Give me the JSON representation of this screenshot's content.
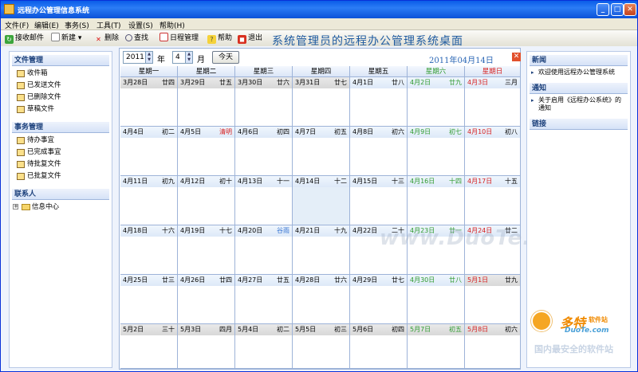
{
  "app": {
    "title": "远程办公管理信息系统",
    "banner": "系统管理员的远程办公管理系统桌面"
  },
  "window_buttons": {
    "minimize": "_",
    "maximize": "□",
    "close": "✕"
  },
  "menu": [
    "文件(F)",
    "编辑(E)",
    "事务(S)",
    "工具(T)",
    "设置(S)",
    "帮助(H)"
  ],
  "toolbar": {
    "receive": "接收邮件",
    "new": "新建",
    "new_arrow": "▾",
    "delete": "删除",
    "find": "查找",
    "schedule": "日程管理",
    "help": "帮助",
    "exit": "退出"
  },
  "sidebar": {
    "files_title": "文件管理",
    "files": [
      "收件箱",
      "已发送文件",
      "已删除文件",
      "草稿文件"
    ],
    "affairs_title": "事务管理",
    "affairs": [
      "待办事宜",
      "已完成事宜",
      "待批复文件",
      "已批复文件"
    ],
    "contacts_title": "联系人",
    "tree_toggle": "+",
    "tree": [
      "信息中心"
    ]
  },
  "calendar": {
    "year": "2011",
    "year_label": "年",
    "month": "4",
    "month_label": "月",
    "today_btn": "今天",
    "current_date": "2011年04月14日",
    "close": "✕",
    "weekdays": [
      "星期一",
      "星期二",
      "星期三",
      "星期四",
      "星期五",
      "星期六",
      "星期日"
    ],
    "weeks": [
      [
        {
          "d": "3月28日",
          "l": "廿四"
        },
        {
          "d": "3月29日",
          "l": "廿五"
        },
        {
          "d": "3月30日",
          "l": "廿六"
        },
        {
          "d": "3月31日",
          "l": "廿七"
        },
        {
          "d": "4月1日",
          "l": "廿八"
        },
        {
          "d": "4月2日",
          "l": "廿九"
        },
        {
          "d": "4月3日",
          "l": "三月"
        }
      ],
      [
        {
          "d": "4月4日",
          "l": "初二"
        },
        {
          "d": "4月5日",
          "l": "清明"
        },
        {
          "d": "4月6日",
          "l": "初四"
        },
        {
          "d": "4月7日",
          "l": "初五"
        },
        {
          "d": "4月8日",
          "l": "初六"
        },
        {
          "d": "4月9日",
          "l": "初七"
        },
        {
          "d": "4月10日",
          "l": "初八"
        }
      ],
      [
        {
          "d": "4月11日",
          "l": "初九"
        },
        {
          "d": "4月12日",
          "l": "初十"
        },
        {
          "d": "4月13日",
          "l": "十一"
        },
        {
          "d": "4月14日",
          "l": "十二"
        },
        {
          "d": "4月15日",
          "l": "十三"
        },
        {
          "d": "4月16日",
          "l": "十四"
        },
        {
          "d": "4月17日",
          "l": "十五"
        }
      ],
      [
        {
          "d": "4月18日",
          "l": "十六"
        },
        {
          "d": "4月19日",
          "l": "十七"
        },
        {
          "d": "4月20日",
          "l": "谷雨"
        },
        {
          "d": "4月21日",
          "l": "十九"
        },
        {
          "d": "4月22日",
          "l": "二十"
        },
        {
          "d": "4月23日",
          "l": "廿一"
        },
        {
          "d": "4月24日",
          "l": "廿二"
        }
      ],
      [
        {
          "d": "4月25日",
          "l": "廿三"
        },
        {
          "d": "4月26日",
          "l": "廿四"
        },
        {
          "d": "4月27日",
          "l": "廿五"
        },
        {
          "d": "4月28日",
          "l": "廿六"
        },
        {
          "d": "4月29日",
          "l": "廿七"
        },
        {
          "d": "4月30日",
          "l": "廿八"
        },
        {
          "d": "5月1日",
          "l": "廿九"
        }
      ],
      [
        {
          "d": "5月2日",
          "l": "三十"
        },
        {
          "d": "5月3日",
          "l": "四月"
        },
        {
          "d": "5月4日",
          "l": "初二"
        },
        {
          "d": "5月5日",
          "l": "初三"
        },
        {
          "d": "5月6日",
          "l": "初四"
        },
        {
          "d": "5月7日",
          "l": "初五"
        },
        {
          "d": "5月8日",
          "l": "初六"
        }
      ]
    ]
  },
  "right_panel": {
    "news_title": "新闻",
    "news": [
      "欢迎使用远程办公管理系统"
    ],
    "notice_title": "通知",
    "notices": [
      "关于启用《远程办公系统》的通知"
    ],
    "links_title": "链接"
  },
  "watermark": {
    "text": "www.DuoTe.com",
    "logo_cn": "多特",
    "logo_sub": "软件站",
    "logo_en": "DuoTe.com",
    "slogan": "国内最安全的软件站"
  },
  "colors": {
    "title": "#0a5ce8",
    "banner": "#1f5ba0",
    "saturday": "#2e9a2e",
    "sunday": "#d62020",
    "selected": "#e4eef8"
  }
}
